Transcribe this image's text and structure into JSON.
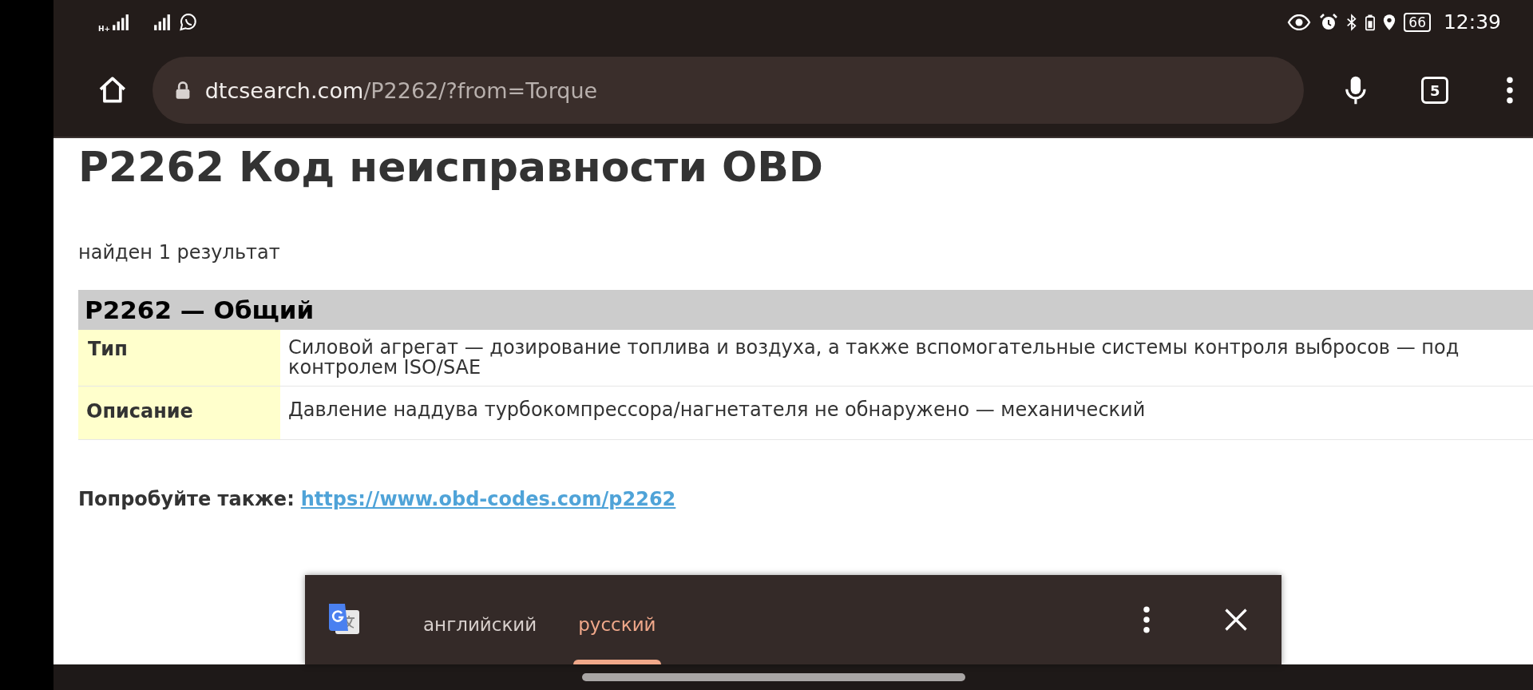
{
  "status_bar": {
    "network_type": "H+",
    "battery": "66",
    "time": "12:39"
  },
  "address_bar": {
    "domain": "dtcsearch.com",
    "path": "/P2262/?from=Torque",
    "tab_count": "5"
  },
  "page": {
    "title": "P2262 Код неисправности OBD",
    "result_count": "найден 1 результат",
    "table": {
      "heading": "P2262 — Общий",
      "rows": [
        {
          "label": "Тип",
          "value": "Силовой агрегат — дозирование топлива и воздуха, а также вспомогательные системы контроля выбросов — под контролем ISO/SAE"
        },
        {
          "label": "Описание",
          "value": "Давление наддува турбокомпрессора/нагнетателя не обнаружено — механический"
        }
      ]
    },
    "see_also": {
      "label": "Попробуйте также:",
      "link": "https://www.obd-codes.com/p2262"
    }
  },
  "translate_bar": {
    "languages": [
      {
        "label": "английский",
        "selected": false
      },
      {
        "label": "русский",
        "selected": true
      }
    ]
  }
}
